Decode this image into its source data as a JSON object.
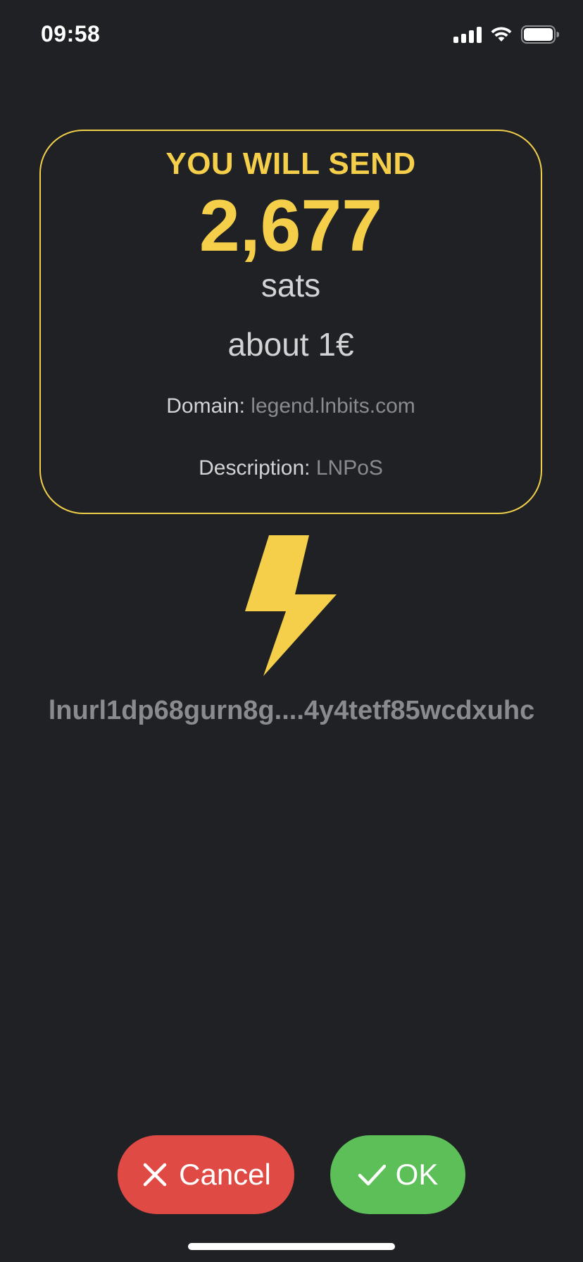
{
  "status_bar": {
    "time": "09:58",
    "icons": [
      "signal-icon",
      "wifi-icon",
      "battery-icon"
    ]
  },
  "card": {
    "title": "YOU WILL SEND",
    "amount": "2,677",
    "unit": "sats",
    "fiat": "about 1€",
    "domain_label": "Domain:",
    "domain_value": "legend.lnbits.com",
    "description_label": "Description:",
    "description_value": "LNPoS"
  },
  "lnurl": "lnurl1dp68gurn8g....4y4tetf85wcdxuhc",
  "buttons": {
    "cancel_label": "Cancel",
    "ok_label": "OK"
  },
  "colors": {
    "background": "#1f2125",
    "accent": "#f5cf4a",
    "cancel": "#e04a45",
    "ok": "#5cbf57",
    "muted": "#8a8b8e"
  }
}
